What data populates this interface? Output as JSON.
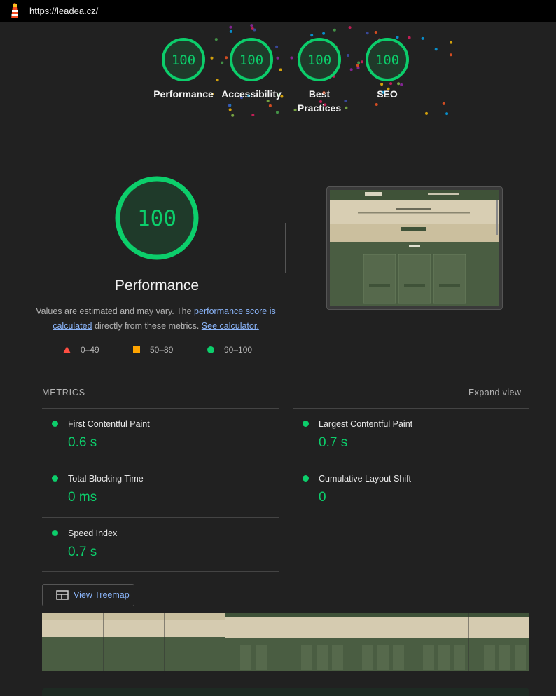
{
  "browser": {
    "url": "https://leadea.cz/"
  },
  "header_gauges": [
    {
      "score": "100",
      "label": "Performance"
    },
    {
      "score": "100",
      "label": "Accessibility"
    },
    {
      "score": "100",
      "label_line1": "Best",
      "label_line2": "Practices"
    },
    {
      "score": "100",
      "label": "SEO"
    }
  ],
  "performance": {
    "score": "100",
    "title": "Performance",
    "desc_start": "Values are estimated and may vary. The ",
    "link_score": "performance score is calculated",
    "desc_mid": " directly from these metrics. ",
    "link_calc": "See calculator."
  },
  "legend": {
    "fail": "0–49",
    "average": "50–89",
    "pass": "90–100"
  },
  "metrics": {
    "title": "METRICS",
    "expand": "Expand view",
    "items": [
      {
        "name": "First Contentful Paint",
        "value": "0.6 s"
      },
      {
        "name": "Largest Contentful Paint",
        "value": "0.7 s"
      },
      {
        "name": "Total Blocking Time",
        "value": "0 ms"
      },
      {
        "name": "Cumulative Layout Shift",
        "value": "0"
      },
      {
        "name": "Speed Index",
        "value": "0.7 s"
      }
    ]
  },
  "treemap": {
    "label": "View Treemap"
  },
  "colors": {
    "pass": "#0cce6b",
    "average": "#ffa400",
    "fail": "#ff4e42",
    "link": "#8ab4f8",
    "background": "#212121"
  }
}
